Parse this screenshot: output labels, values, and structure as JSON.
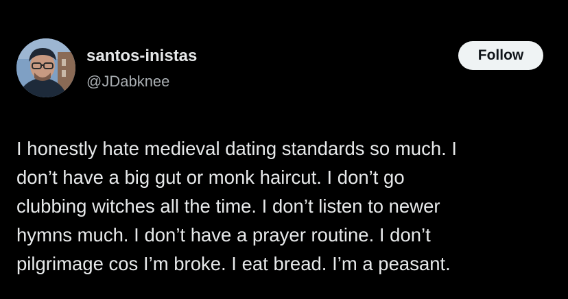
{
  "author": {
    "display_name": "santos-inistas",
    "handle": "@JDabknee",
    "avatar_icon": "user-avatar-photo"
  },
  "actions": {
    "follow_label": "Follow"
  },
  "tweet": {
    "lines": [
      "I honestly hate medieval dating standards so much. I",
      "don’t have a big gut or monk haircut. I don’t go",
      "clubbing witches all the time. I don’t listen to newer",
      "hymns much. I don’t have a prayer routine. I don’t",
      "pilgrimage cos I’m broke. I eat bread. I’m a peasant."
    ]
  },
  "colors": {
    "background": "#000000",
    "primary_text": "#e7e9ea",
    "secondary_text": "#a9aeb2",
    "follow_button_bg": "#eff3f4",
    "follow_button_text": "#0f1419"
  }
}
